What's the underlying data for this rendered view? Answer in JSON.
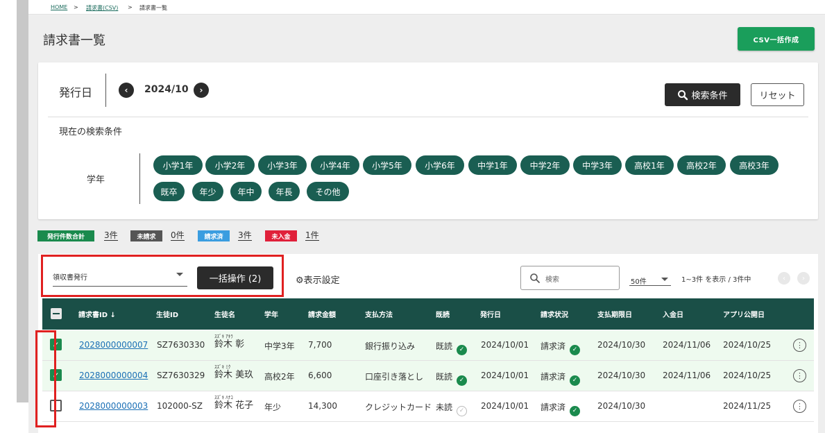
{
  "breadcrumb": {
    "home": "HOME",
    "sep": ">",
    "csv": "請求書(CSV)",
    "current": "請求書一覧"
  },
  "page_title": "請求書一覧",
  "csv_button": "CSV一括作成",
  "filter": {
    "label": "発行日",
    "month": "2024/10",
    "prev_icon": "chevron-left-icon",
    "next_icon": "chevron-right-icon",
    "search_button": "検索条件",
    "reset_button": "リセット",
    "current_conditions_title": "現在の検索条件",
    "grade_label": "学年",
    "grades": [
      "小学1年",
      "小学2年",
      "小学3年",
      "小学4年",
      "小学5年",
      "小学6年",
      "中学1年",
      "中学2年",
      "中学3年",
      "高校1年",
      "高校2年",
      "高校3年",
      "既卒",
      "年少",
      "年中",
      "年長",
      "その他"
    ]
  },
  "counts": [
    {
      "label": "発行件数合計",
      "value": "3件",
      "color": "#1a8a4d"
    },
    {
      "label": "未請求",
      "value": "0件",
      "color": "#555555"
    },
    {
      "label": "請求済",
      "value": "3件",
      "color": "#3a9de0"
    },
    {
      "label": "未入金",
      "value": "1件",
      "color": "#e0203a"
    }
  ],
  "toolbar": {
    "action_select": "領収書発行",
    "bulk_button": "一括操作 (2)",
    "display_settings": "表示設定",
    "search_placeholder": "検索",
    "per_page": "50件",
    "range": "1~3件 を表示 / 3件中"
  },
  "table": {
    "headers": [
      "請求書ID",
      "生徒ID",
      "生徒名",
      "学年",
      "請求金額",
      "支払方法",
      "既読",
      "発行日",
      "請求状況",
      "支払期限日",
      "入金日",
      "アプリ公開日"
    ],
    "rows": [
      {
        "checked": true,
        "invoice_id": "2028000000007",
        "student_id": "SZ7630330",
        "furigana": "ｽｽﾞｷ ｱｷﾗ",
        "name": "鈴木 彰",
        "grade": "中学3年",
        "amount": "7,700",
        "method": "銀行振り込み",
        "read": "既読",
        "read_ok": true,
        "issued": "2024/10/01",
        "status": "請求済",
        "due": "2024/10/30",
        "paid": "2024/11/06",
        "app": "2024/10/25"
      },
      {
        "checked": true,
        "invoice_id": "2028000000004",
        "student_id": "SZ7630329",
        "furigana": "ｽｽﾞｷ ﾐｸ",
        "name": "鈴木 美玖",
        "grade": "高校2年",
        "amount": "6,600",
        "method": "口座引き落とし",
        "read": "既読",
        "read_ok": true,
        "issued": "2024/10/01",
        "status": "請求済",
        "due": "2024/10/30",
        "paid": "2024/11/06",
        "app": "2024/10/25"
      },
      {
        "checked": false,
        "invoice_id": "2028000000003",
        "student_id": "102000-SZ",
        "furigana": "ｽｽﾞｷ ﾊﾅｺ",
        "name": "鈴木 花子",
        "grade": "年少",
        "amount": "14,300",
        "method": "クレジットカード",
        "read": "未読",
        "read_ok": false,
        "issued": "2024/10/01",
        "status": "請求済",
        "due": "2024/10/30",
        "paid": "",
        "app": "2024/11/25"
      }
    ]
  }
}
